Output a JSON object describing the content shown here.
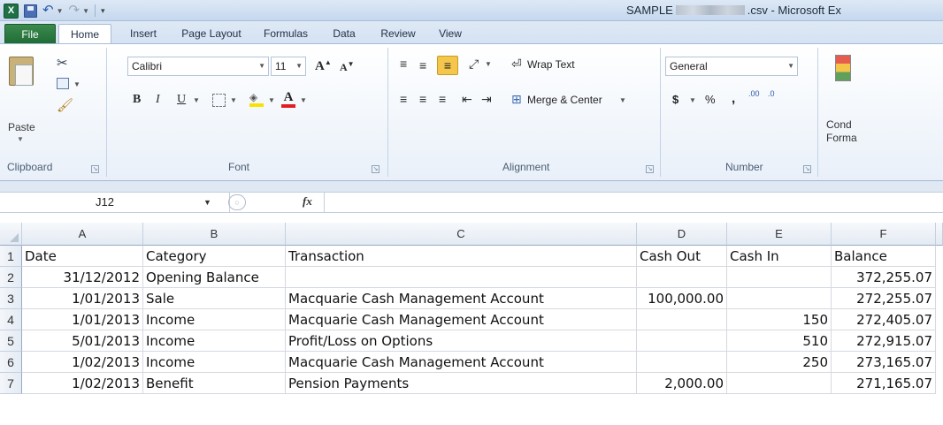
{
  "window": {
    "title_prefix": "SAMPLE",
    "title_suffix": ".csv - Microsoft Ex"
  },
  "ribbon_tabs": [
    "File",
    "Home",
    "Insert",
    "Page Layout",
    "Formulas",
    "Data",
    "Review",
    "View"
  ],
  "clipboard": {
    "paste_label": "Paste",
    "group_label": "Clipboard"
  },
  "font": {
    "font_name": "Calibri",
    "font_size": "11",
    "grow_label": "A",
    "shrink_label": "A",
    "bold_label": "B",
    "italic_label": "I",
    "underline_label": "U",
    "font_color_label": "A",
    "group_label": "Font"
  },
  "alignment": {
    "wrap_text": "Wrap Text",
    "merge_center": "Merge & Center",
    "group_label": "Alignment"
  },
  "number": {
    "format": "General",
    "currency": "$",
    "percent": "%",
    "comma": ",",
    "increase_decimal": ".00",
    "decrease_decimal": ".0",
    "group_label": "Number"
  },
  "styles": {
    "conditional_line1": "Cond",
    "conditional_line2": "Forma"
  },
  "formula_bar": {
    "name_box": "J12",
    "fx": "fx",
    "content": ""
  },
  "sheet": {
    "columns": [
      "A",
      "B",
      "C",
      "D",
      "E",
      "F"
    ],
    "rows": [
      {
        "n": "1",
        "cells": [
          "Date",
          "Category",
          "Transaction",
          "Cash Out",
          "Cash In",
          "Balance"
        ]
      },
      {
        "n": "2",
        "cells": [
          "31/12/2012",
          "Opening Balance",
          "",
          "",
          "",
          "372,255.07"
        ]
      },
      {
        "n": "3",
        "cells": [
          "1/01/2013",
          "Sale",
          "Macquarie Cash Management Account",
          "100,000.00",
          "",
          "272,255.07"
        ]
      },
      {
        "n": "4",
        "cells": [
          "1/01/2013",
          "Income",
          "Macquarie Cash Management Account",
          "",
          "150",
          "272,405.07"
        ]
      },
      {
        "n": "5",
        "cells": [
          "5/01/2013",
          "Income",
          "Profit/Loss on Options",
          "",
          "510",
          "272,915.07"
        ]
      },
      {
        "n": "6",
        "cells": [
          "1/02/2013",
          "Income",
          "Macquarie Cash Management Account",
          "",
          "250",
          "273,165.07"
        ]
      },
      {
        "n": "7",
        "cells": [
          "1/02/2013",
          "Benefit",
          "Pension Payments",
          "2,000.00",
          "",
          "271,165.07"
        ]
      }
    ]
  },
  "colors": {
    "file_tab": "#1f6b35",
    "ribbon_bg": "#e9f0f9",
    "highlight_button": "#f5c64c",
    "font_color_bar": "#e02020",
    "fill_color_bar": "#f5e400"
  }
}
